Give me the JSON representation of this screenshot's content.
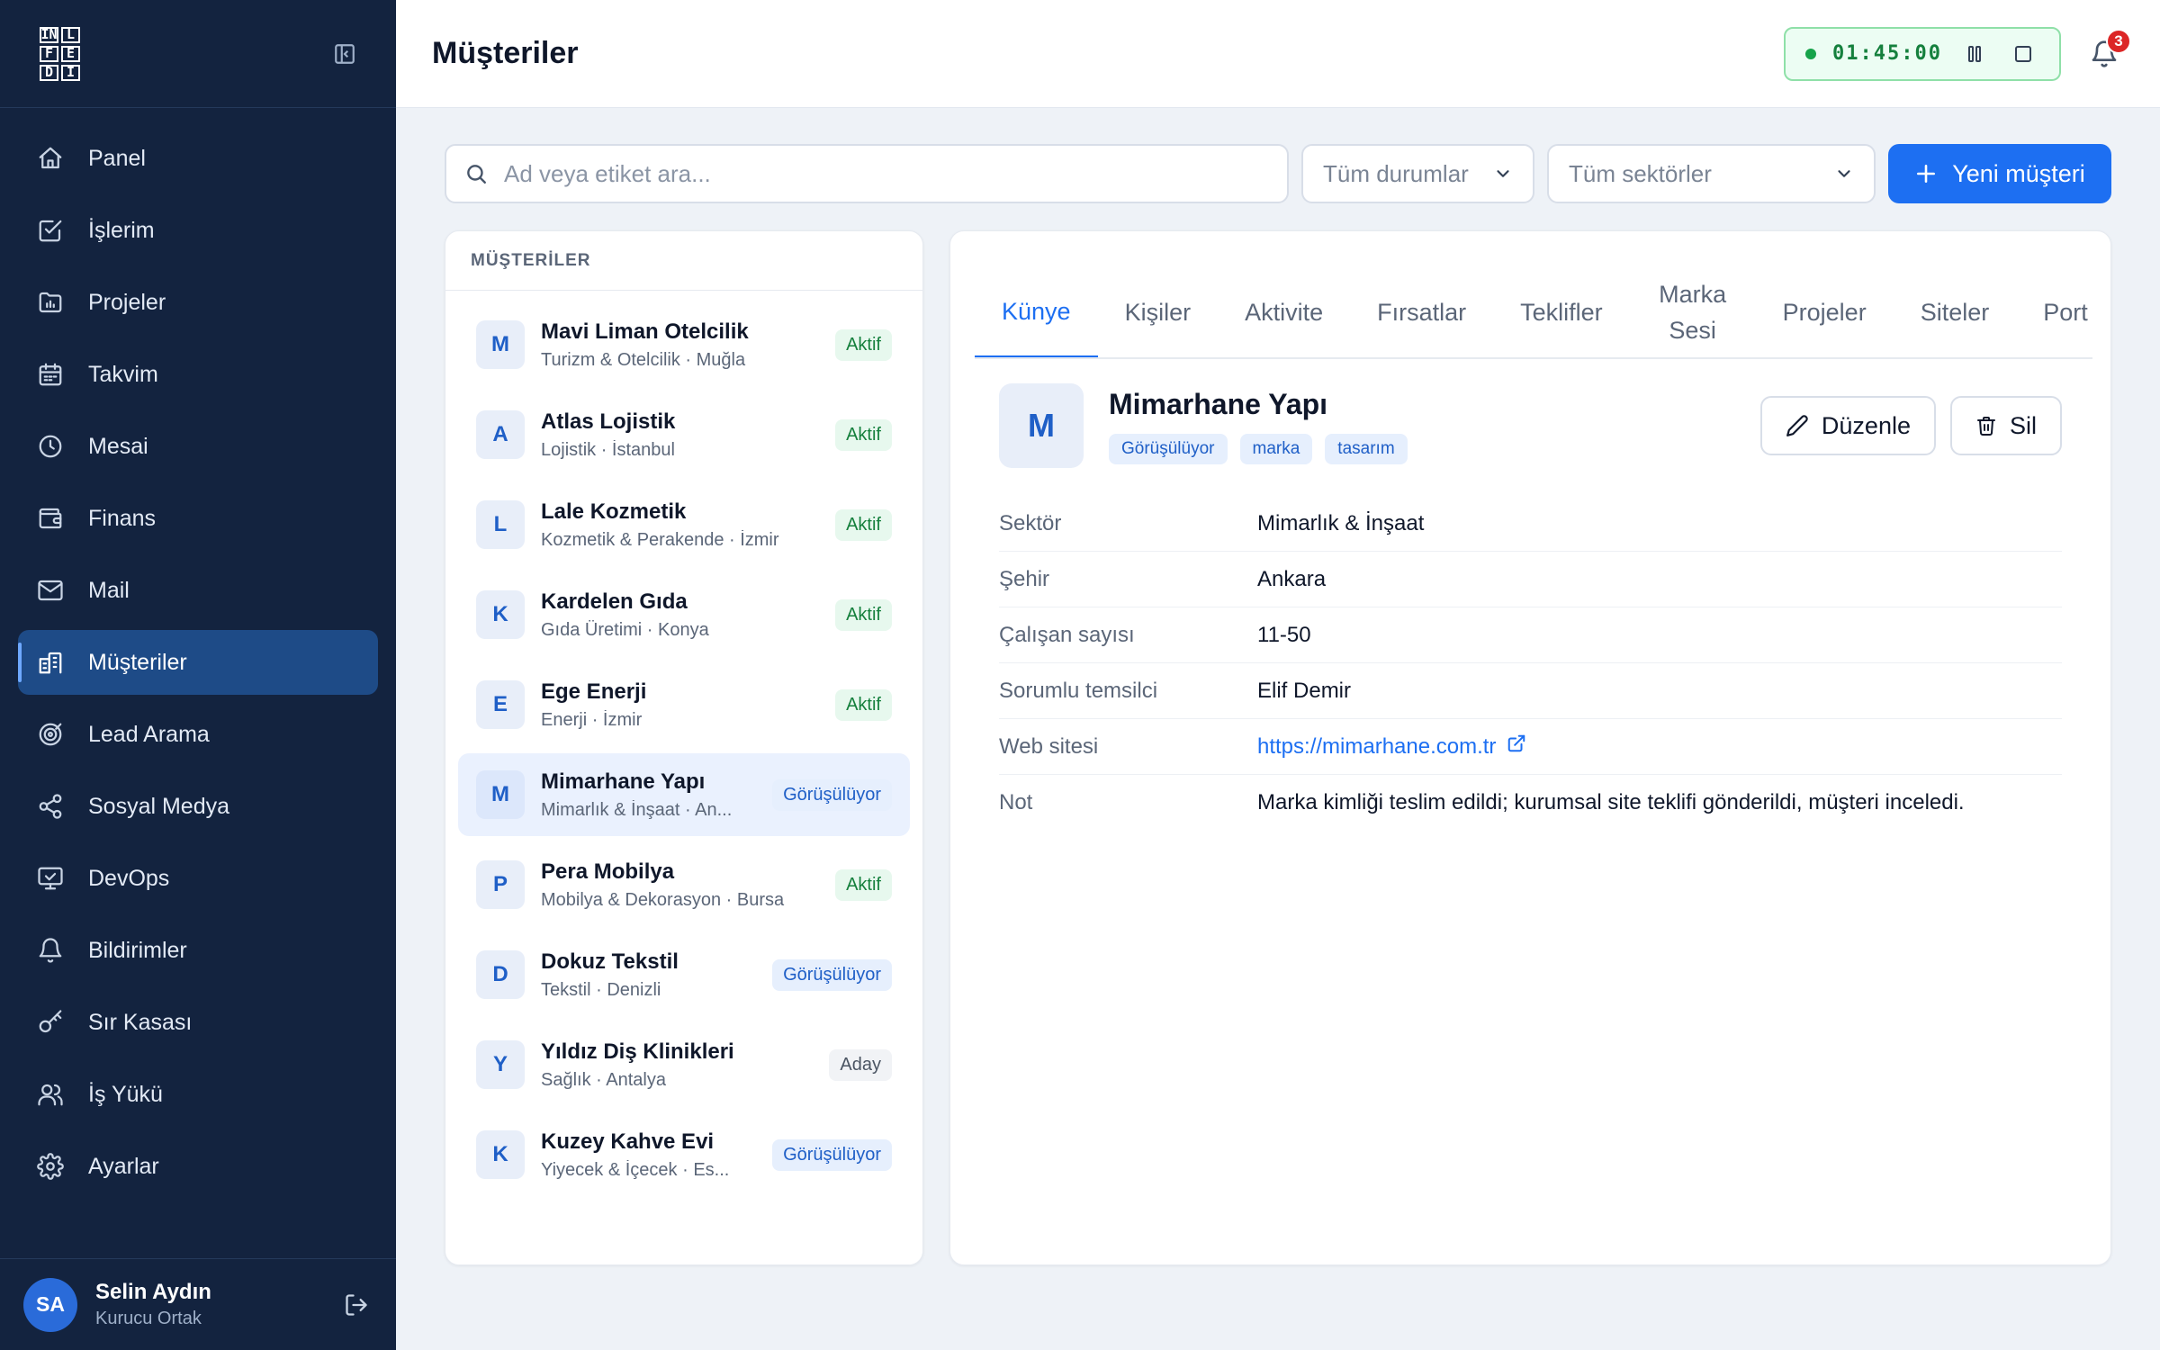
{
  "brand": {
    "logo_rows": [
      [
        "IN",
        "L"
      ],
      [
        "F",
        "E"
      ],
      [
        "D",
        "I"
      ]
    ]
  },
  "sidebar": {
    "items": [
      {
        "label": "Panel",
        "icon": "home-icon",
        "active": false
      },
      {
        "label": "İşlerim",
        "icon": "checkbox-icon",
        "active": false
      },
      {
        "label": "Projeler",
        "icon": "folder-chart-icon",
        "active": false
      },
      {
        "label": "Takvim",
        "icon": "calendar-icon",
        "active": false
      },
      {
        "label": "Mesai",
        "icon": "clock-icon",
        "active": false
      },
      {
        "label": "Finans",
        "icon": "wallet-icon",
        "active": false
      },
      {
        "label": "Mail",
        "icon": "mail-icon",
        "active": false
      },
      {
        "label": "Müşteriler",
        "icon": "building-icon",
        "active": true
      },
      {
        "label": "Lead Arama",
        "icon": "target-icon",
        "active": false
      },
      {
        "label": "Sosyal Medya",
        "icon": "share-icon",
        "active": false
      },
      {
        "label": "DevOps",
        "icon": "monitor-icon",
        "active": false
      },
      {
        "label": "Bildirimler",
        "icon": "bell-icon",
        "active": false
      },
      {
        "label": "Sır Kasası",
        "icon": "key-icon",
        "active": false
      },
      {
        "label": "İş Yükü",
        "icon": "users-icon",
        "active": false
      },
      {
        "label": "Ayarlar",
        "icon": "gear-icon",
        "active": false
      }
    ],
    "user": {
      "initials": "SA",
      "name": "Selin Aydın",
      "role": "Kurucu Ortak"
    }
  },
  "header": {
    "title": "Müşteriler",
    "timer": "01:45:00",
    "notification_count": "3"
  },
  "toolbar": {
    "search_placeholder": "Ad veya etiket ara...",
    "status_filter": "Tüm durumlar",
    "sector_filter": "Tüm sektörler",
    "new_button": "Yeni müşteri"
  },
  "list": {
    "heading": "MÜŞTERİLER",
    "items": [
      {
        "initial": "M",
        "name": "Mavi Liman Otelcilik",
        "sub": "Turizm & Otelcilik · Muğla",
        "status": "Aktif",
        "status_color": "green",
        "selected": false
      },
      {
        "initial": "A",
        "name": "Atlas Lojistik",
        "sub": "Lojistik · İstanbul",
        "status": "Aktif",
        "status_color": "green",
        "selected": false
      },
      {
        "initial": "L",
        "name": "Lale Kozmetik",
        "sub": "Kozmetik & Perakende · İzmir",
        "status": "Aktif",
        "status_color": "green",
        "selected": false
      },
      {
        "initial": "K",
        "name": "Kardelen Gıda",
        "sub": "Gıda Üretimi · Konya",
        "status": "Aktif",
        "status_color": "green",
        "selected": false
      },
      {
        "initial": "E",
        "name": "Ege Enerji",
        "sub": "Enerji · İzmir",
        "status": "Aktif",
        "status_color": "green",
        "selected": false
      },
      {
        "initial": "M",
        "name": "Mimarhane Yapı",
        "sub": "Mimarlık & İnşaat · An...",
        "status": "Görüşülüyor",
        "status_color": "blue",
        "selected": true
      },
      {
        "initial": "P",
        "name": "Pera Mobilya",
        "sub": "Mobilya & Dekorasyon · Bursa",
        "status": "Aktif",
        "status_color": "green",
        "selected": false
      },
      {
        "initial": "D",
        "name": "Dokuz Tekstil",
        "sub": "Tekstil · Denizli",
        "status": "Görüşülüyor",
        "status_color": "blue",
        "selected": false
      },
      {
        "initial": "Y",
        "name": "Yıldız Diş Klinikleri",
        "sub": "Sağlık · Antalya",
        "status": "Aday",
        "status_color": "gray",
        "selected": false
      },
      {
        "initial": "K",
        "name": "Kuzey Kahve Evi",
        "sub": "Yiyecek & İçecek · Es...",
        "status": "Görüşülüyor",
        "status_color": "blue",
        "selected": false
      }
    ]
  },
  "detail": {
    "tabs": [
      {
        "label": "Künye",
        "active": true
      },
      {
        "label": "Kişiler",
        "active": false
      },
      {
        "label": "Aktivite",
        "active": false
      },
      {
        "label": "Fırsatlar",
        "active": false
      },
      {
        "label": "Teklifler",
        "active": false
      },
      {
        "label": "Marka Sesi",
        "active": false
      },
      {
        "label": "Projeler",
        "active": false
      },
      {
        "label": "Siteler",
        "active": false
      },
      {
        "label": "Port",
        "active": false
      }
    ],
    "initial": "M",
    "name": "Mimarhane Yapı",
    "tags": [
      "Görüşülüyor",
      "marka",
      "tasarım"
    ],
    "edit_label": "Düzenle",
    "delete_label": "Sil",
    "fields": [
      {
        "key": "Sektör",
        "value": "Mimarlık & İnşaat",
        "link": false
      },
      {
        "key": "Şehir",
        "value": "Ankara",
        "link": false
      },
      {
        "key": "Çalışan sayısı",
        "value": "11-50",
        "link": false
      },
      {
        "key": "Sorumlu temsilci",
        "value": "Elif Demir",
        "link": false
      },
      {
        "key": "Web sitesi",
        "value": "https://mimarhane.com.tr",
        "link": true
      },
      {
        "key": "Not",
        "value": "Marka kimliği teslim edildi; kurumsal site teklifi gönderildi, müşteri inceledi.",
        "link": false
      }
    ]
  }
}
